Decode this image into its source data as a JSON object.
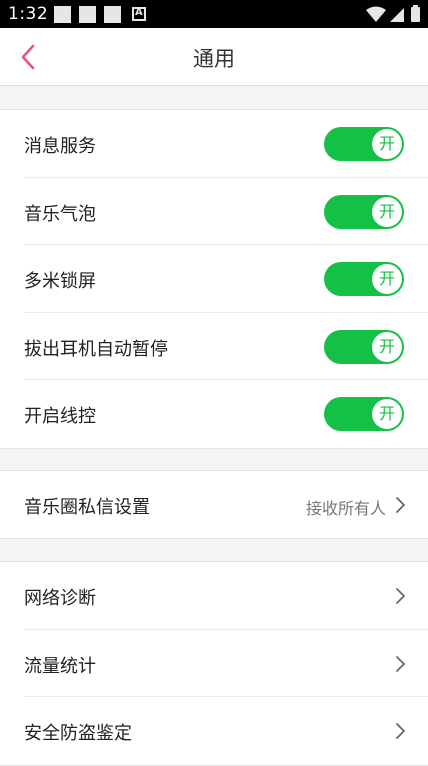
{
  "status_bar": {
    "time": "1:32"
  },
  "header": {
    "title": "通用",
    "back_icon": "chevron-left-icon"
  },
  "colors": {
    "accent": "#e9508d",
    "toggle_on": "#15c046"
  },
  "toggles": [
    {
      "label": "消息服务",
      "state": "开",
      "on": true
    },
    {
      "label": "音乐气泡",
      "state": "开",
      "on": true
    },
    {
      "label": "多米锁屏",
      "state": "开",
      "on": true
    },
    {
      "label": "拔出耳机自动暂停",
      "state": "开",
      "on": true
    },
    {
      "label": "开启线控",
      "state": "开",
      "on": true
    }
  ],
  "message_settings": {
    "label": "音乐圈私信设置",
    "value": "接收所有人"
  },
  "tools": [
    {
      "label": "网络诊断"
    },
    {
      "label": "流量统计"
    },
    {
      "label": "安全防盗鉴定"
    }
  ]
}
